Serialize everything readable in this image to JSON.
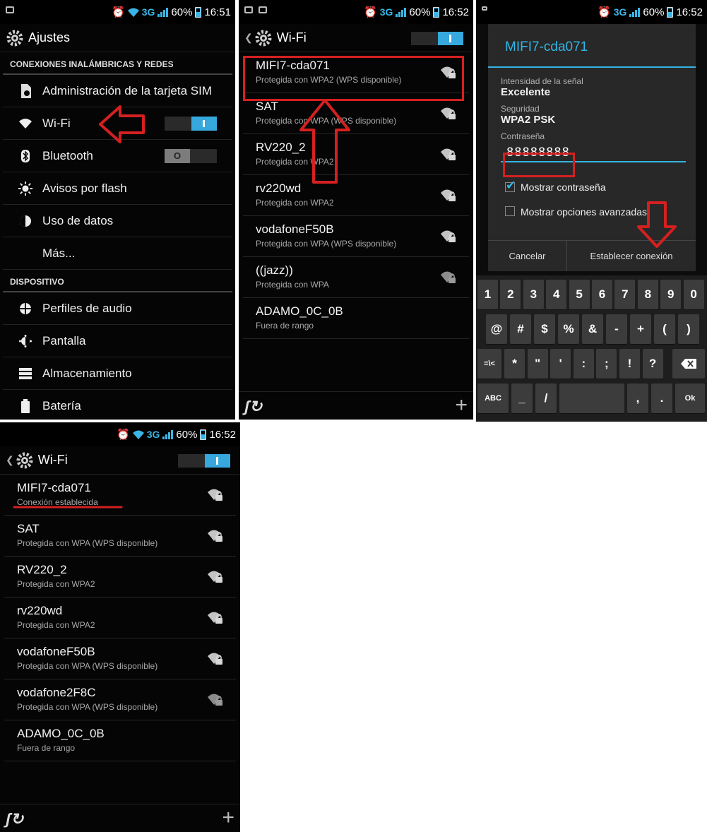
{
  "status": {
    "net": "3G",
    "battery": "60%",
    "time_p1": "16:51",
    "time_p2": "16:52",
    "time_p3": "16:52",
    "time_p4": "16:52"
  },
  "colors": {
    "accent": "#33b5e5",
    "highlight": "#d52020",
    "background": "#050505"
  },
  "settings": {
    "title": "Ajustes",
    "section_wireless": "CONEXIONES INALÁMBRICAS Y REDES",
    "section_device": "DISPOSITIVO",
    "items": [
      {
        "label": "Administración de la tarjeta SIM",
        "icon": "sim-icon"
      },
      {
        "label": "Wi-Fi",
        "icon": "wifi-icon"
      },
      {
        "label": "Bluetooth",
        "icon": "bluetooth-icon"
      },
      {
        "label": "Avisos por flash",
        "icon": "flash-icon"
      },
      {
        "label": "Uso de datos",
        "icon": "data-usage-icon"
      },
      {
        "label": "Más...",
        "icon": ""
      },
      {
        "label": "Perfiles de audio",
        "icon": "audio-profile-icon"
      },
      {
        "label": "Pantalla",
        "icon": "display-icon"
      },
      {
        "label": "Almacenamiento",
        "icon": "storage-icon"
      },
      {
        "label": "Batería",
        "icon": "battery-icon"
      }
    ],
    "bluetooth_toggle": "O"
  },
  "wifi": {
    "title": "Wi-Fi",
    "networks": [
      {
        "ssid": "MIFI7-cda071",
        "status": "Protegida con WPA2 (WPS disponible)"
      },
      {
        "ssid": "SAT",
        "status": "Protegida con WPA (WPS disponible)"
      },
      {
        "ssid": "RV220_2",
        "status": "Protegida con WPA2"
      },
      {
        "ssid": "rv220wd",
        "status": "Protegida con WPA2"
      },
      {
        "ssid": "vodafoneF50B",
        "status": "Protegida con WPA (WPS disponible)"
      },
      {
        "ssid": "((jazz))",
        "status": "Protegida con WPA"
      },
      {
        "ssid": "ADAMO_0C_0B",
        "status": "Fuera de rango"
      }
    ],
    "networks_after": [
      {
        "ssid": "MIFI7-cda071",
        "status": "Conexión establecida"
      },
      {
        "ssid": "SAT",
        "status": "Protegida con WPA (WPS disponible)"
      },
      {
        "ssid": "RV220_2",
        "status": "Protegida con WPA2"
      },
      {
        "ssid": "rv220wd",
        "status": "Protegida con WPA2"
      },
      {
        "ssid": "vodafoneF50B",
        "status": "Protegida con WPA (WPS disponible)"
      },
      {
        "ssid": "vodafone2F8C",
        "status": "Protegida con WPA (WPS disponible)"
      },
      {
        "ssid": "ADAMO_0C_0B",
        "status": "Fuera de rango"
      }
    ]
  },
  "dialog": {
    "title": "MIFI7-cda071",
    "signal_label": "Intensidad de la señal",
    "signal_value": "Excelente",
    "security_label": "Seguridad",
    "security_value": "WPA2 PSK",
    "password_label": "Contraseña",
    "password_value": "88888888",
    "show_password": "Mostrar contraseña",
    "advanced_options": "Mostrar opciones avanzadas",
    "cancel": "Cancelar",
    "connect": "Establecer conexión"
  },
  "keyboard": {
    "row1": [
      "1",
      "2",
      "3",
      "4",
      "5",
      "6",
      "7",
      "8",
      "9",
      "0"
    ],
    "row2": [
      "@",
      "#",
      "$",
      "%",
      "&",
      "-",
      "+",
      "(",
      ")"
    ],
    "row3": [
      "=\\<",
      "*",
      "\"",
      "'",
      ":",
      ";",
      "!",
      "?"
    ],
    "row4": [
      "ABC",
      "_",
      "/",
      "",
      ",",
      ".",
      "Ok"
    ]
  }
}
